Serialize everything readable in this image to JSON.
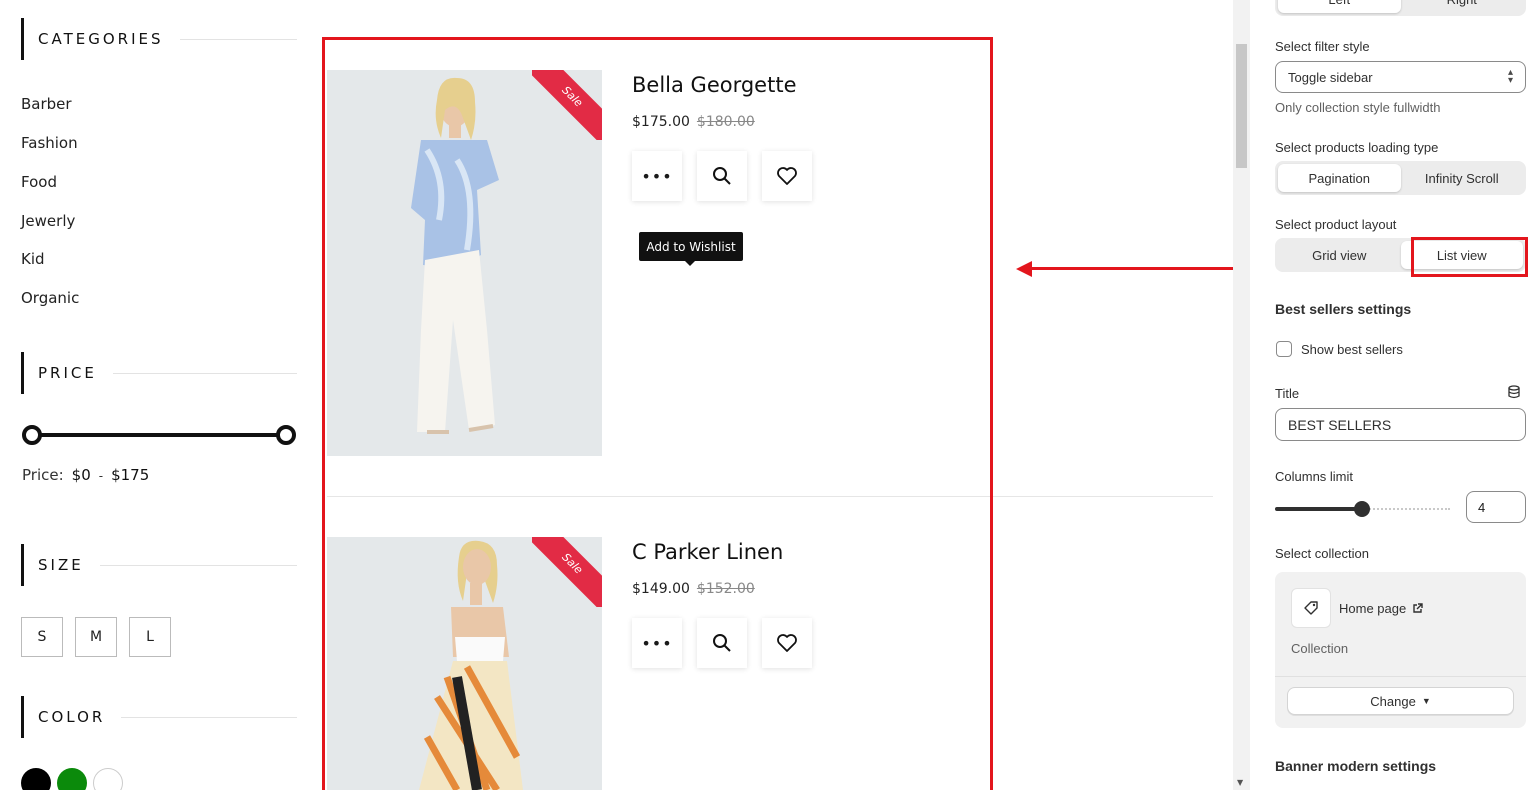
{
  "sidebar": {
    "categories_title": "CATEGORIES",
    "categories": [
      "Barber",
      "Fashion",
      "Food",
      "Jewerly",
      "Kid",
      "Organic"
    ],
    "price_title": "PRICE",
    "price_label": "Price:",
    "price_min": "$0",
    "price_sep": "-",
    "price_max": "$175",
    "size_title": "SIZE",
    "sizes": [
      "S",
      "M",
      "L"
    ],
    "color_title": "COLOR",
    "colors": [
      "#000000",
      "#0b8a0b",
      "#ffffff"
    ]
  },
  "products": [
    {
      "title": "Bella Georgette",
      "price": "$175.00",
      "old_price": "$180.00",
      "badge": "Sale"
    },
    {
      "title": "C Parker Linen",
      "price": "$149.00",
      "old_price": "$152.00",
      "badge": "Sale"
    }
  ],
  "tooltip": "Add to Wishlist",
  "panel": {
    "seg_top": [
      "Left",
      "Right"
    ],
    "filter_style_label": "Select filter style",
    "filter_style_value": "Toggle sidebar",
    "filter_help": "Only collection style fullwidth",
    "loading_label": "Select products loading type",
    "loading_options": [
      "Pagination",
      "Infinity Scroll"
    ],
    "layout_label": "Select product layout",
    "layout_options": [
      "Grid view",
      "List view"
    ],
    "best_heading": "Best sellers settings",
    "show_best": "Show best sellers",
    "title_label": "Title",
    "title_value": "BEST SELLERS",
    "columns_label": "Columns limit",
    "columns_value": "4",
    "collection_label": "Select collection",
    "collection_name": "Home page",
    "collection_sub": "Collection",
    "change_label": "Change",
    "banner_heading": "Banner modern settings"
  }
}
